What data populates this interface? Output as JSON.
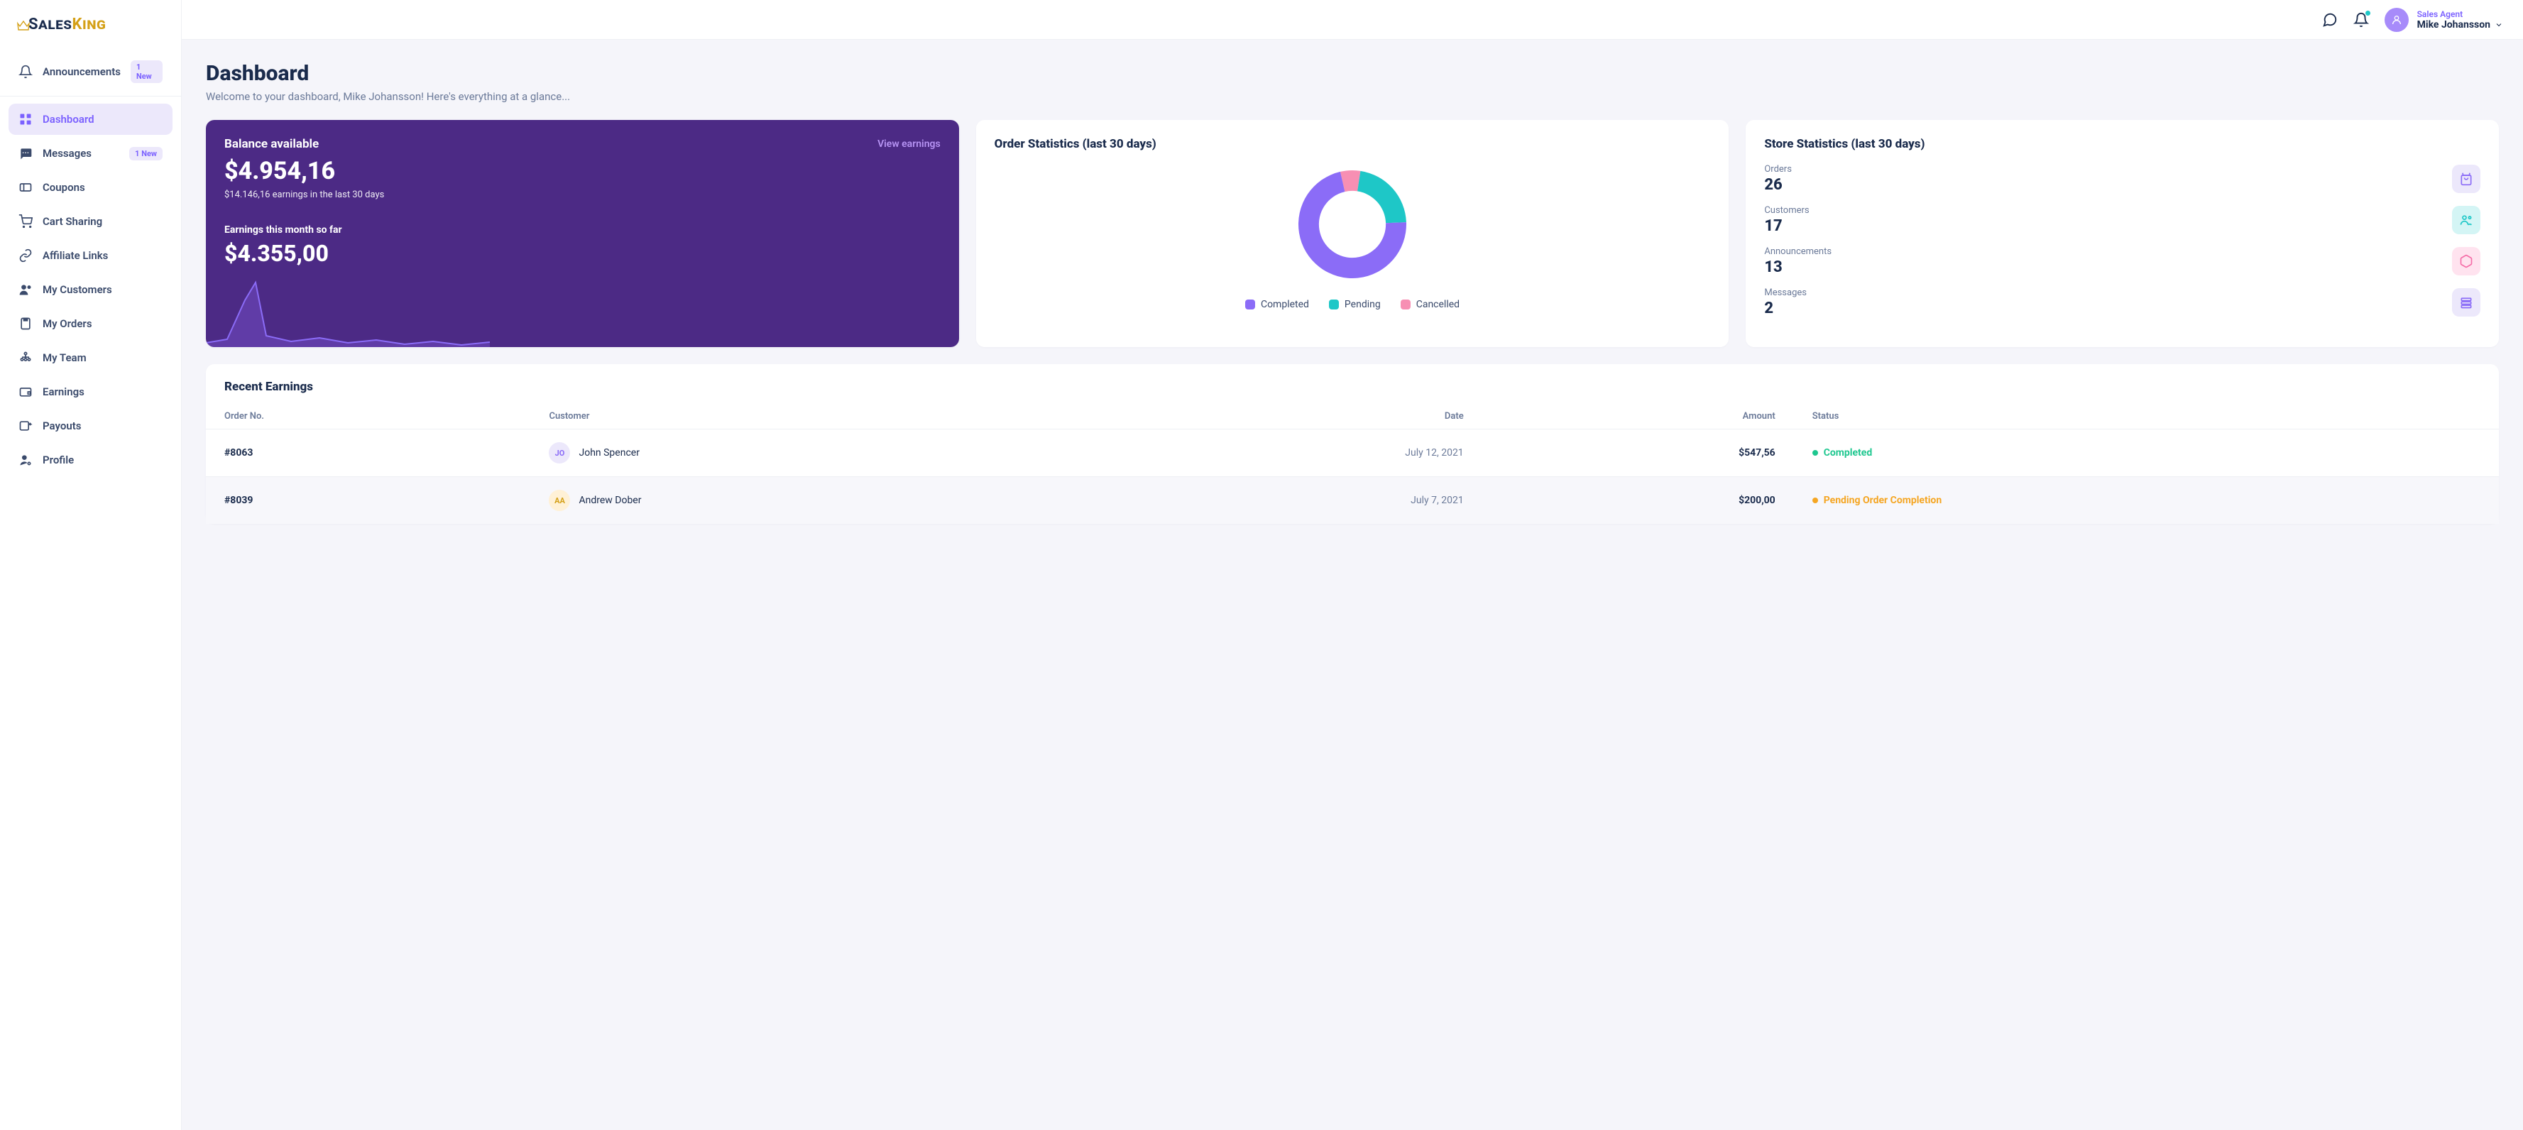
{
  "brand": {
    "sales": "Sales",
    "king": "King"
  },
  "sidebar": {
    "items": [
      {
        "label": "Announcements",
        "badge": "1 New"
      },
      {
        "label": "Dashboard",
        "active": true
      },
      {
        "label": "Messages",
        "badge": "1 New"
      },
      {
        "label": "Coupons"
      },
      {
        "label": "Cart Sharing"
      },
      {
        "label": "Affiliate Links"
      },
      {
        "label": "My Customers"
      },
      {
        "label": "My Orders"
      },
      {
        "label": "My Team"
      },
      {
        "label": "Earnings"
      },
      {
        "label": "Payouts"
      },
      {
        "label": "Profile"
      }
    ]
  },
  "header": {
    "role": "Sales Agent",
    "username": "Mike Johansson"
  },
  "page": {
    "title": "Dashboard",
    "subtitle": "Welcome to your dashboard, Mike Johansson! Here's everything at a glance..."
  },
  "balance": {
    "title": "Balance available",
    "view_link": "View earnings",
    "amount": "$4.954,16",
    "subtext": "$14.146,16 earnings in the last 30 days",
    "month_title": "Earnings this month so far",
    "month_amount": "$4.355,00"
  },
  "order_stats": {
    "title": "Order Statistics (last 30 days)",
    "legend": {
      "completed": "Completed",
      "pending": "Pending",
      "cancelled": "Cancelled"
    }
  },
  "chart_data": {
    "type": "pie",
    "title": "Order Statistics (last 30 days)",
    "series": [
      {
        "name": "Completed",
        "value": 72,
        "color": "#8b6cf7"
      },
      {
        "name": "Pending",
        "value": 22,
        "color": "#1ec7c7"
      },
      {
        "name": "Cancelled",
        "value": 6,
        "color": "#f78fb3"
      }
    ],
    "donut_inner_ratio": 0.62
  },
  "store_stats": {
    "title": "Store Statistics (last 30 days)",
    "items": [
      {
        "label": "Orders",
        "value": "26",
        "icon_bg": "#ece8fb",
        "icon_color": "#8b6cf7"
      },
      {
        "label": "Customers",
        "value": "17",
        "icon_bg": "#d4f5f5",
        "icon_color": "#1ec7c7"
      },
      {
        "label": "Announcements",
        "value": "13",
        "icon_bg": "#ffe3ef",
        "icon_color": "#f56da8"
      },
      {
        "label": "Messages",
        "value": "2",
        "icon_bg": "#ece8fb",
        "icon_color": "#8b6cf7"
      }
    ]
  },
  "recent": {
    "title": "Recent Earnings",
    "columns": {
      "order": "Order No.",
      "customer": "Customer",
      "date": "Date",
      "amount": "Amount",
      "status": "Status"
    },
    "rows": [
      {
        "order": "#8063",
        "customer_initials": "JO",
        "customer_name": "John Spencer",
        "av_bg": "#ece8fb",
        "av_color": "#8b6cf7",
        "date": "July 12, 2021",
        "amount": "$547,56",
        "status_label": "Completed",
        "status_color": "#1ec78f"
      },
      {
        "order": "#8039",
        "customer_initials": "AA",
        "customer_name": "Andrew Dober",
        "av_bg": "#fff1d6",
        "av_color": "#d4a017",
        "date": "July 7, 2021",
        "amount": "$200,00",
        "status_label": "Pending Order Completion",
        "status_color": "#f5a623"
      }
    ]
  },
  "colors": {
    "purple": "#8b6cf7",
    "teal": "#1ec7c7",
    "pink": "#f78fb3"
  }
}
